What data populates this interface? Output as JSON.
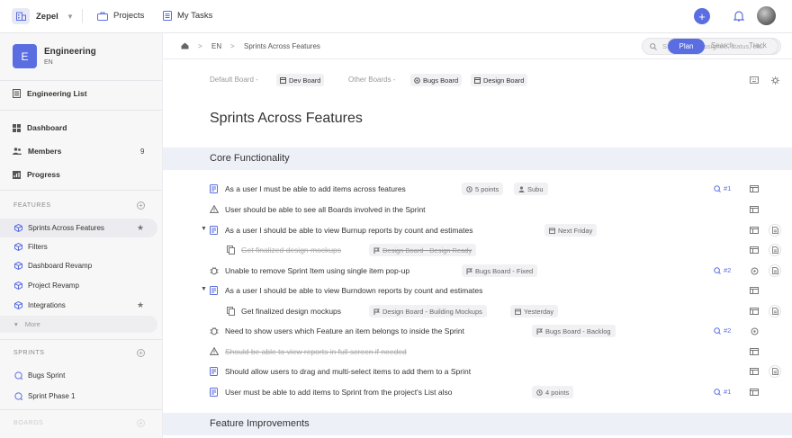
{
  "topbar": {
    "workspace_name": "Zepel",
    "projects_label": "Projects",
    "tasks_label": "My Tasks",
    "add_label": "+"
  },
  "sidebar": {
    "project_letter": "E",
    "project_name": "Engineering",
    "project_code": "EN",
    "list_label": "Engineering List",
    "nav": [
      {
        "label": "Dashboard",
        "icon": "dashboard-icon"
      },
      {
        "label": "Members",
        "icon": "members-icon",
        "count": "9"
      },
      {
        "label": "Progress",
        "icon": "progress-icon"
      }
    ],
    "features_heading": "FEATURES",
    "features": [
      {
        "label": "Sprints Across Features",
        "starred": true,
        "active": true
      },
      {
        "label": "Filters",
        "starred": false
      },
      {
        "label": "Dashboard Revamp",
        "starred": false
      },
      {
        "label": "Project Revamp",
        "starred": false
      },
      {
        "label": "Integrations",
        "starred": true
      }
    ],
    "more_label": "More",
    "sprints_heading": "SPRINTS",
    "sprints": [
      "Bugs Sprint",
      "Sprint Phase 1"
    ],
    "boards_heading": "BOARDS"
  },
  "crumbs": {
    "project": "EN",
    "page": "Sprints Across Features"
  },
  "search": {
    "placeholder": "Search text, assignee, status, etc."
  },
  "modes": {
    "plan": "Plan",
    "search": "Search",
    "track": "Track"
  },
  "boards": {
    "default_label": "Default Board -",
    "default_board": "Dev Board",
    "other_label": "Other Boards -",
    "other_boards": [
      "Bugs Board",
      "Design Board"
    ]
  },
  "page_title": "Sprints Across Features",
  "sections": [
    {
      "title": "Core Functionality"
    },
    {
      "title": "Feature Improvements"
    }
  ],
  "items": [
    {
      "title": "As a user I must be able to add items across features",
      "type": "story",
      "tags": [
        "5 points",
        "Subu"
      ],
      "ref": "#1"
    },
    {
      "title": "User should be able to see all Boards involved in the Sprint",
      "type": "warning",
      "tags": []
    },
    {
      "title": "As a user I should be able to view Burnup reports by count and estimates",
      "type": "story",
      "tags": [
        "Next Friday"
      ],
      "expandable": true
    },
    {
      "title": "Get finalized design mockups",
      "type": "subtask",
      "tags": [
        "Design Board - Design Ready"
      ],
      "done": true
    },
    {
      "title": "Unable to remove Sprint Item using single item pop-up",
      "type": "bug",
      "tags": [
        "Bugs Board - Fixed"
      ],
      "ref": "#2"
    },
    {
      "title": "As a user I should be able to view Burndown reports by count and estimates",
      "type": "story",
      "tags": [],
      "expandable": true
    },
    {
      "title": "Get finalized design mockups",
      "type": "subtask",
      "tags": [
        "Design Board - Building Mockups",
        "Yesterday"
      ]
    },
    {
      "title": "Need to show users which Feature an item belongs to inside the Sprint",
      "type": "bug",
      "tags": [
        "Bugs Board - Backlog"
      ],
      "ref": "#2"
    },
    {
      "title": "Should be able to view reports in full screen if needed",
      "type": "warning",
      "tags": [],
      "done": true
    },
    {
      "title": "Should allow users to drag and multi-select items to add them to a Sprint",
      "type": "story",
      "tags": []
    },
    {
      "title": "User must be able to add items to Sprint from the project's List also",
      "type": "story",
      "tags": [
        "4 points"
      ],
      "ref": "#1"
    }
  ],
  "colors": {
    "accent": "#5b6ee1",
    "band": "#eef0f8",
    "sidebar": "#f7f7f8"
  }
}
